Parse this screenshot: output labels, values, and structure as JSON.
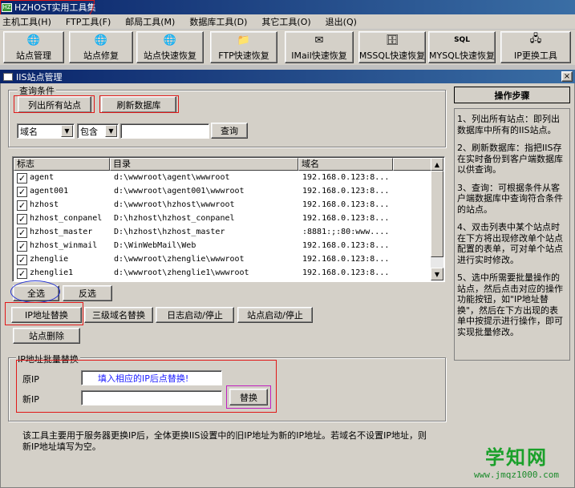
{
  "app": {
    "title": "HZHOST实用工具集"
  },
  "menu": [
    "主机工具(H)",
    "FTP工具(F)",
    "邮局工具(M)",
    "数据库工具(D)",
    "其它工具(O)",
    "退出(Q)"
  ],
  "toolbar": [
    {
      "label": "站点管理",
      "icon": "globe-icon"
    },
    {
      "label": "站点修复",
      "icon": "globe-icon"
    },
    {
      "label": "站点快速恢复",
      "icon": "globe-icon"
    },
    {
      "label": "FTP快速恢复",
      "icon": "ftp-icon"
    },
    {
      "label": "IMail快速恢复",
      "icon": "mail-icon"
    },
    {
      "label": "MSSQL快速恢复",
      "icon": "database-icon"
    },
    {
      "label": "MYSQL快速恢复",
      "icon": "sql-icon"
    },
    {
      "label": "IP更换工具",
      "icon": "network-icon"
    }
  ],
  "window": {
    "title": "IIS站点管理",
    "close": "×"
  },
  "query": {
    "group_title": "查询条件",
    "list_all": "列出所有站点",
    "refresh": "刷新数据库",
    "field": "域名",
    "op": "包含",
    "value": "",
    "query_btn": "查询"
  },
  "table": {
    "headers": [
      "标志",
      "目录",
      "域名"
    ],
    "rows": [
      {
        "flag": "agent",
        "dir": "d:\\wwwroot\\agent\\wwwroot",
        "domain": "192.168.0.123:8..."
      },
      {
        "flag": "agent001",
        "dir": "d:\\wwwroot\\agent001\\wwwroot",
        "domain": "192.168.0.123:8..."
      },
      {
        "flag": "hzhost",
        "dir": "d:\\wwwroot\\hzhost\\wwwroot",
        "domain": "192.168.0.123:8..."
      },
      {
        "flag": "hzhost_conpanel",
        "dir": "D:\\hzhost\\hzhost_conpanel",
        "domain": "192.168.0.123:8..."
      },
      {
        "flag": "hzhost_master",
        "dir": "D:\\hzhost\\hzhost_master",
        "domain": ":8881:;:80:www...."
      },
      {
        "flag": "hzhost_winmail",
        "dir": "D:\\WinWebMail\\Web",
        "domain": "192.168.0.123:8..."
      },
      {
        "flag": "zhenglie",
        "dir": "d:\\wwwroot\\zhenglie\\wwwroot",
        "domain": "192.168.0.123:8..."
      },
      {
        "flag": "zhenglie1",
        "dir": "d:\\wwwroot\\zhenglie1\\wwwroot",
        "domain": "192.168.0.123:8..."
      }
    ]
  },
  "actions": {
    "select_all": "全选",
    "invert": "反选",
    "ip_replace": "IP地址替换",
    "subdomain_replace": "三级域名替换",
    "log_toggle": "日志启动/停止",
    "site_toggle": "站点启动/停止",
    "delete_site": "站点删除"
  },
  "ipbatch": {
    "group_title": "IP地址批量替换",
    "old_label": "原IP",
    "old_value": "填入相应的IP后点替换!",
    "new_label": "新IP",
    "new_value": "",
    "replace_btn": "替换"
  },
  "note": "该工具主要用于服务器更换IP后，全体更换IIS设置中的旧IP地址为新的IP地址。若域名不设置IP地址，则新IP地址填写为空。",
  "steps": {
    "title": "操作步骤",
    "items": [
      "1、列出所有站点：即列出数据库中所有的IIS站点。",
      "2、刷新数据库：指把IIS存在实时备份到客户端数据库以供查询。",
      "3、查询：可根据条件从客户端数据库中查询符合条件的站点。",
      "4、双击列表中某个站点时在下方将出现修改单个站点配置的表单，可对单个站点进行实时修改。",
      "5、选中所需要批量操作的站点，然后点击对应的操作功能按钮，如\"IP地址替换\"，然后在下方出现的表单中按提示进行操作，即可实现批量修改。"
    ]
  },
  "watermark": {
    "main": "学知网",
    "url": "www.jmqz1000.com"
  }
}
